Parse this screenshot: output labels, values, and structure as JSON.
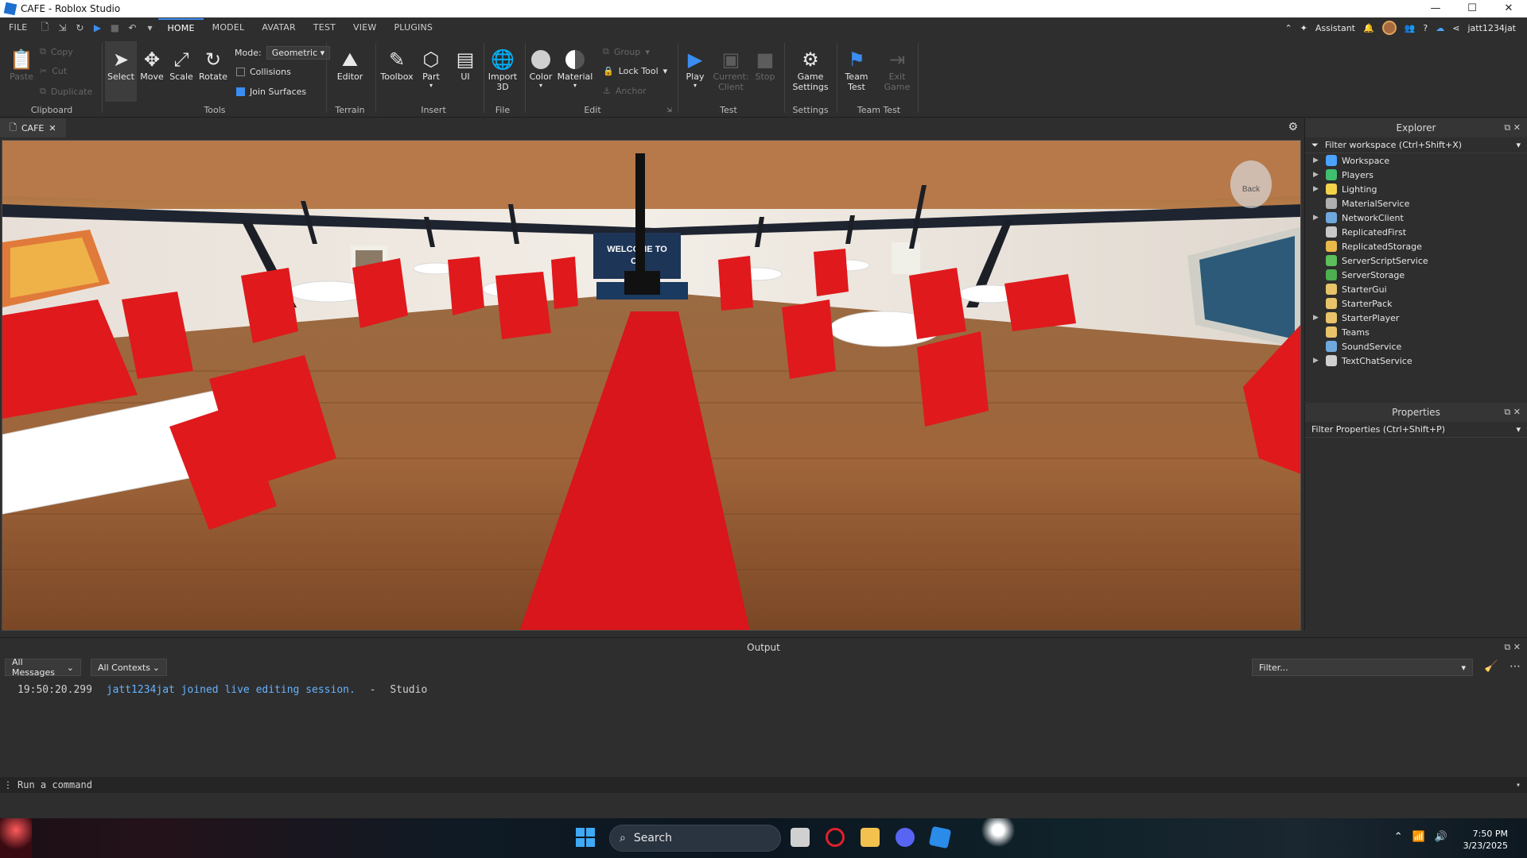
{
  "window": {
    "title": "CAFE - Roblox Studio",
    "minimize": "—",
    "maximize": "☐",
    "close": "✕"
  },
  "menu": {
    "file": "FILE",
    "tabs": [
      "HOME",
      "MODEL",
      "AVATAR",
      "TEST",
      "VIEW",
      "PLUGINS"
    ],
    "assistant": "Assistant",
    "username": "jatt1234jat"
  },
  "ribbon": {
    "clipboard": {
      "paste": "Paste",
      "copy": "Copy",
      "cut": "Cut",
      "duplicate": "Duplicate",
      "label": "Clipboard"
    },
    "tools": {
      "select": "Select",
      "move": "Move",
      "scale": "Scale",
      "rotate": "Rotate",
      "label": "Tools",
      "mode_label": "Mode:",
      "mode_value": "Geometric",
      "collisions": "Collisions",
      "join_surfaces": "Join Surfaces"
    },
    "terrain": {
      "editor": "Editor",
      "label": "Terrain"
    },
    "insert": {
      "toolbox": "Toolbox",
      "part": "Part",
      "ui": "UI",
      "label": "Insert"
    },
    "file": {
      "import3d_line1": "Import",
      "import3d_line2": "3D",
      "label": "File"
    },
    "edit": {
      "color": "Color",
      "material": "Material",
      "group": "Group",
      "lock_tool": "Lock Tool",
      "anchor": "Anchor",
      "label": "Edit"
    },
    "test": {
      "play": "Play",
      "current_client_1": "Current:",
      "current_client_2": "Client",
      "stop": "Stop",
      "label": "Test"
    },
    "settings": {
      "game_settings_1": "Game",
      "game_settings_2": "Settings",
      "label": "Settings"
    },
    "team_test": {
      "team_test_1": "Team",
      "team_test_2": "Test",
      "exit_game_1": "Exit",
      "exit_game_2": "Game",
      "label": "Team Test"
    }
  },
  "doc_tab": {
    "name": "CAFE",
    "close": "✕"
  },
  "viewport": {
    "sign_line1": "WELCOME TO",
    "sign_line2": "CA",
    "nav_cube": "Back"
  },
  "explorer": {
    "title": "Explorer",
    "filter": "Filter workspace (Ctrl+Shift+X)",
    "items": [
      {
        "label": "Workspace",
        "expandable": true,
        "color": "#4aa3ff"
      },
      {
        "label": "Players",
        "expandable": true,
        "color": "#3fbf6f"
      },
      {
        "label": "Lighting",
        "expandable": true,
        "color": "#f2d34a"
      },
      {
        "label": "MaterialService",
        "expandable": false,
        "color": "#b0b0b0"
      },
      {
        "label": "NetworkClient",
        "expandable": true,
        "color": "#6fa8dc"
      },
      {
        "label": "ReplicatedFirst",
        "expandable": false,
        "color": "#c8c8c8"
      },
      {
        "label": "ReplicatedStorage",
        "expandable": false,
        "color": "#e8b84a"
      },
      {
        "label": "ServerScriptService",
        "expandable": false,
        "color": "#5cbf5c"
      },
      {
        "label": "ServerStorage",
        "expandable": false,
        "color": "#4caf50"
      },
      {
        "label": "StarterGui",
        "expandable": false,
        "color": "#e8c36a"
      },
      {
        "label": "StarterPack",
        "expandable": false,
        "color": "#e8c36a"
      },
      {
        "label": "StarterPlayer",
        "expandable": true,
        "color": "#e8c36a"
      },
      {
        "label": "Teams",
        "expandable": false,
        "color": "#e8c36a"
      },
      {
        "label": "SoundService",
        "expandable": false,
        "color": "#6fa8dc"
      },
      {
        "label": "TextChatService",
        "expandable": true,
        "color": "#d0d0d0"
      }
    ]
  },
  "properties": {
    "title": "Properties",
    "filter": "Filter Properties (Ctrl+Shift+P)"
  },
  "output": {
    "title": "Output",
    "messages_filter": "All Messages",
    "contexts_filter": "All Contexts",
    "filter_placeholder": "Filter...",
    "log": {
      "time": "19:50:20.299",
      "message": "jatt1234jat joined live editing session.",
      "sep": "-",
      "source": "Studio"
    },
    "command_placeholder": "Run a command"
  },
  "taskbar": {
    "search": "Search",
    "time": "7:50 PM",
    "date": "3/23/2025"
  }
}
